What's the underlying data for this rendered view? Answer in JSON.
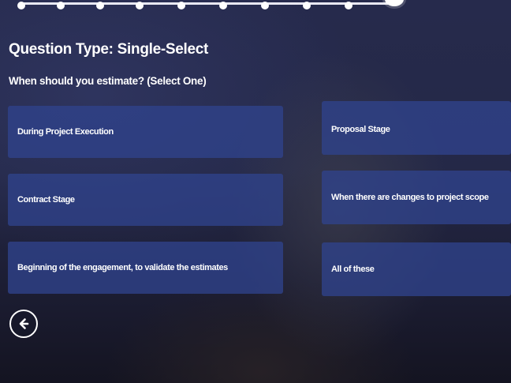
{
  "progress": {
    "completed_steps": 9,
    "current_step": 10,
    "colors": {
      "track": "#e8e8f2",
      "dot": "#ffffff"
    }
  },
  "question": {
    "type_label": "Question Type: Single-Select",
    "prompt": "When should you estimate? (Select One)"
  },
  "options": [
    {
      "label": "During Project Execution"
    },
    {
      "label": "Proposal Stage"
    },
    {
      "label": "Contract Stage"
    },
    {
      "label": "When there are changes to project scope"
    },
    {
      "label": "Beginning of the engagement, to validate the estimates"
    },
    {
      "label": "All of these"
    }
  ],
  "navigation": {
    "back_icon": "arrow-left-icon"
  },
  "colors": {
    "background": "#242847",
    "option_fill": "#30428c",
    "text": "#ffffff"
  }
}
